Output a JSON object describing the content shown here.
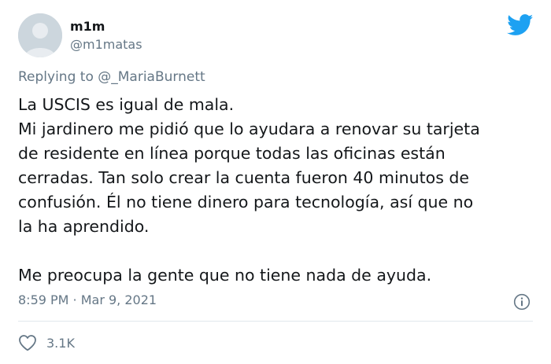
{
  "author": {
    "name": "m1m",
    "handle": "@m1matas"
  },
  "reply": {
    "prefix": "Replying to",
    "mention": "@_MariaBurnett"
  },
  "tweet": {
    "lines": [
      "La USCIS es igual de mala.",
      "Mi jardinero me pidió que lo ayudara a renovar su tarjeta",
      "de residente en línea porque todas las oficinas están",
      "cerradas. Tan solo crear la cuenta fueron 40 minutos de",
      "confusión. Él no tiene dinero para tecnología, así que no",
      "la ha aprendido.",
      "",
      "Me preocupa la gente que no tiene nada de ayuda."
    ],
    "timestamp": "8:59 PM · Mar 9, 2021"
  },
  "stats": {
    "likes": "3.1K"
  },
  "icons": {
    "brand": "twitter-bird-icon",
    "info": "info-icon",
    "like": "heart-icon",
    "avatar": "default-avatar-icon"
  },
  "colors": {
    "brand": "#1DA1F2",
    "text": "#14171a",
    "muted": "#657786",
    "divider": "#e1e8ed",
    "avatar_bg": "#ccd6dd"
  }
}
